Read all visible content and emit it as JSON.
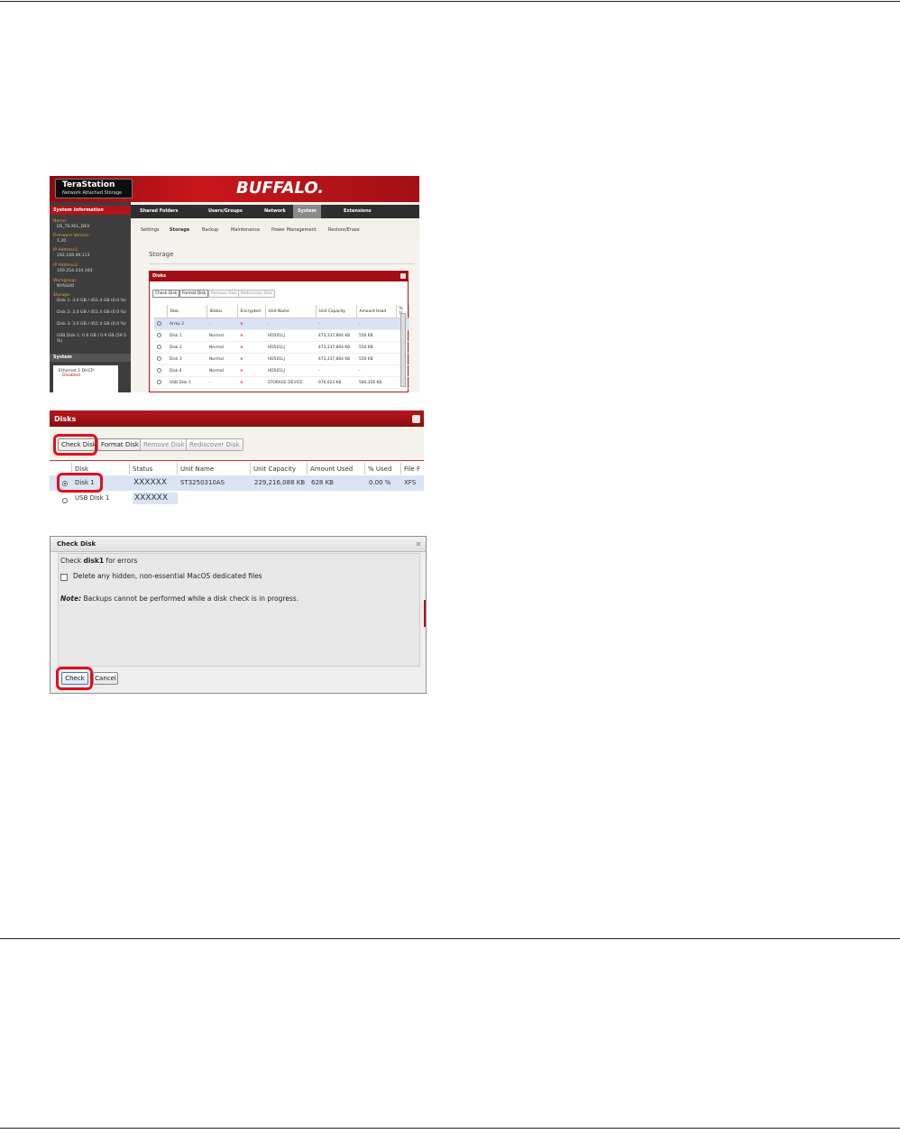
{
  "shot1": {
    "logo_name": "TeraStation",
    "logo_sub": "Network Attached Storage",
    "brand": "BUFFALO.",
    "nav": [
      "Shared Folders",
      "Users/Groups",
      "Network",
      "System",
      "Extensions"
    ],
    "nav_active": "System",
    "subnav": [
      "Settings",
      "Storage",
      "Backup",
      "Maintenance",
      "Power Management",
      "Restore/Erase"
    ],
    "subnav_active": "Storage",
    "sidebar": {
      "title": "System Information",
      "name_label": "Name:",
      "name_value": "DS_TS-XEL_DEV",
      "firmware_label": "Firmware Version:",
      "firmware_value": "1.20",
      "ip1_label": "IP Address1:",
      "ip1_value": "192.168.49.113",
      "ip2_label": "IP Address2:",
      "ip2_value": "169.254.234.164",
      "workgroup_label": "Workgroup:",
      "workgroup_value": "NYASOO",
      "storage_label": "Storage:",
      "storage_lines": [
        "Disk 1: 3.0 GB / 451.4 GB (0.0 %)",
        "Disk 2: 3.0 GB / 451.4 GB (0.0 %)",
        "Disk 3: 3.0 GB / 451.4 GB (0.0 %)",
        "USB Disk 1: 0.6 GB / 0.9 GB (59.5 %)"
      ],
      "system_title": "System",
      "ethernet": "Ethernet 1 DHCP:",
      "ethernet_status": "Disabled"
    },
    "page_title": "Storage",
    "panel_title": "Disks",
    "buttons": [
      "Check Disk",
      "Format Disk",
      "Remove Disk",
      "Rediscover Disk"
    ],
    "columns": [
      "Disk",
      "Status",
      "Encrypted",
      "Unit Name",
      "Unit Capacity",
      "Amount Used",
      "% U"
    ],
    "rows": [
      {
        "disk": "Array 2",
        "status": "-",
        "enc": "×",
        "unit": "-",
        "cap": "-",
        "used": "-"
      },
      {
        "disk": "Disk 1",
        "status": "Normal",
        "enc": "×",
        "unit": "HD501LJ",
        "cap": "473,337,864 KB",
        "used": "556 KB"
      },
      {
        "disk": "Disk 2",
        "status": "Normal",
        "enc": "×",
        "unit": "HD501LJ",
        "cap": "473,337,864 KB",
        "used": "556 KB"
      },
      {
        "disk": "Disk 3",
        "status": "Normal",
        "enc": "×",
        "unit": "HD501LJ",
        "cap": "473,337,864 KB",
        "used": "556 KB"
      },
      {
        "disk": "Disk 4",
        "status": "Normal",
        "enc": "×",
        "unit": "HD501LJ",
        "cap": "-",
        "used": "-"
      },
      {
        "disk": "USB Disk 1",
        "status": "-",
        "enc": "×",
        "unit": "STORAGE DEVICE",
        "cap": "976,024 KB",
        "used": "580,356 KB"
      }
    ]
  },
  "shot2": {
    "title": "Disks",
    "buttons": [
      "Check Disk",
      "Format Disk",
      "Remove Disk",
      "Rediscover Disk"
    ],
    "columns": [
      "Disk",
      "Status",
      "Unit Name",
      "Unit Capacity",
      "Amount Used",
      "% Used",
      "File F"
    ],
    "row1": {
      "disk": "Disk 1",
      "status": "XXXXXX",
      "unit": "ST3250310AS",
      "cap": "229,216,088 KB",
      "used": "628 KB",
      "pct": "0.00 %",
      "fs": "XFS"
    },
    "row2": {
      "disk": "USB Disk 1",
      "status": "XXXXXX"
    }
  },
  "shot3": {
    "title": "Check Disk",
    "line1_pre": "Check ",
    "line1_bold": "disk1",
    "line1_post": " for errors",
    "checkbox_label": "Delete any hidden, non-essential MacOS dedicated files",
    "note_label": "Note:",
    "note_text": " Backups cannot be performed while a disk check is in progress.",
    "check_button": "Check",
    "cancel_button": "Cancel"
  }
}
